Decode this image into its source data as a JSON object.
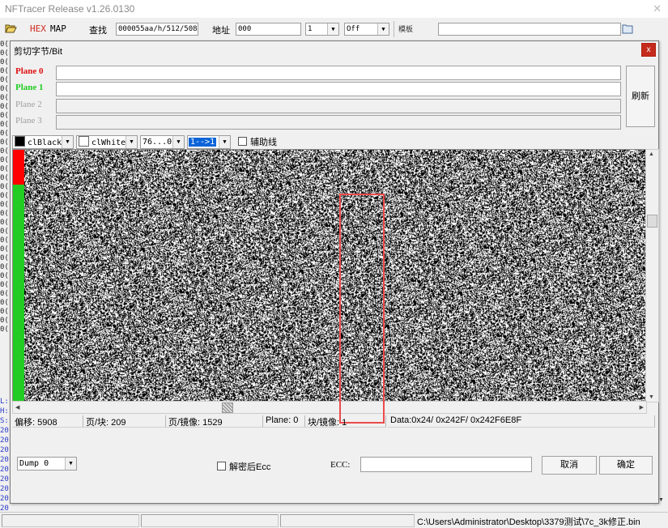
{
  "app": {
    "title": "NFTracer Release v1.26.0130",
    "close_glyph": "✕"
  },
  "toolbar": {
    "open_icon": "folder-open-icon",
    "hex_label": "HEX",
    "map_label": "MAP",
    "find_label": "查找",
    "find_value": "000055aa/h/512/508",
    "addr_label": "地址",
    "addr_value": "000",
    "count_value": "1",
    "mode_value": "Off",
    "mode2_label": "模板",
    "right_value": "",
    "browse_icon": "folder-icon"
  },
  "background": {
    "hex_col": [
      "0(",
      "0(",
      "0(",
      "0(",
      "0(",
      "0(",
      "0(",
      "0(",
      "0(",
      "0(",
      "0(",
      "0(",
      "0(",
      "0(",
      "0(",
      "0(",
      "0(",
      "0(",
      "0(",
      "0(",
      "0(",
      "0(",
      "0(",
      "0(",
      "0(",
      "0(",
      "0(",
      "0(",
      "0(",
      "0(",
      "0(",
      "0(",
      "0("
    ],
    "lower_col": [
      "L:",
      "H:",
      "S:",
      "",
      "",
      "",
      "20",
      "20",
      "20",
      "20",
      "20",
      "20",
      "20",
      "20",
      "20"
    ]
  },
  "dialog": {
    "title": "剪切字节/Bit",
    "close_glyph": "x",
    "planes": [
      {
        "label": "Plane 0",
        "color": "#e01010",
        "enabled": true
      },
      {
        "label": "Plane 1",
        "color": "#22cc22",
        "enabled": true
      },
      {
        "label": "Plane 2",
        "color": "#a0a0a0",
        "enabled": false
      },
      {
        "label": "Plane 3",
        "color": "#a0a0a0",
        "enabled": false
      }
    ],
    "refresh_label": "刷新",
    "fg_color": "clBlack",
    "bg_color": "clWhite",
    "bit_order": "76...0",
    "bit_map": "1-->1",
    "guide_label": "辅助线",
    "info": {
      "offset": "偏移: 5908",
      "page_block": "页/块: 209",
      "page_mirror": "页/镜像: 1529",
      "plane": "Plane: 0",
      "block_mirror": "块/镜像: 1",
      "data": "Data:0x24/ 0x242F/ 0x242F6E8F"
    },
    "dump_value": "Dump 0",
    "decrypt_ecc_label": "解密后Ecc",
    "ecc_label": "ECC:",
    "ecc_value": "",
    "cancel_label": "取消",
    "ok_label": "确定"
  },
  "statusbar": {
    "path": "C:\\Users\\Administrator\\Desktop\\3379测试\\7c_3k修正.bin"
  },
  "colors": {
    "plane0": "#ff0000",
    "plane1": "#22cc22",
    "highlight": "#ec4b4b",
    "close_red": "#c42b1c"
  }
}
